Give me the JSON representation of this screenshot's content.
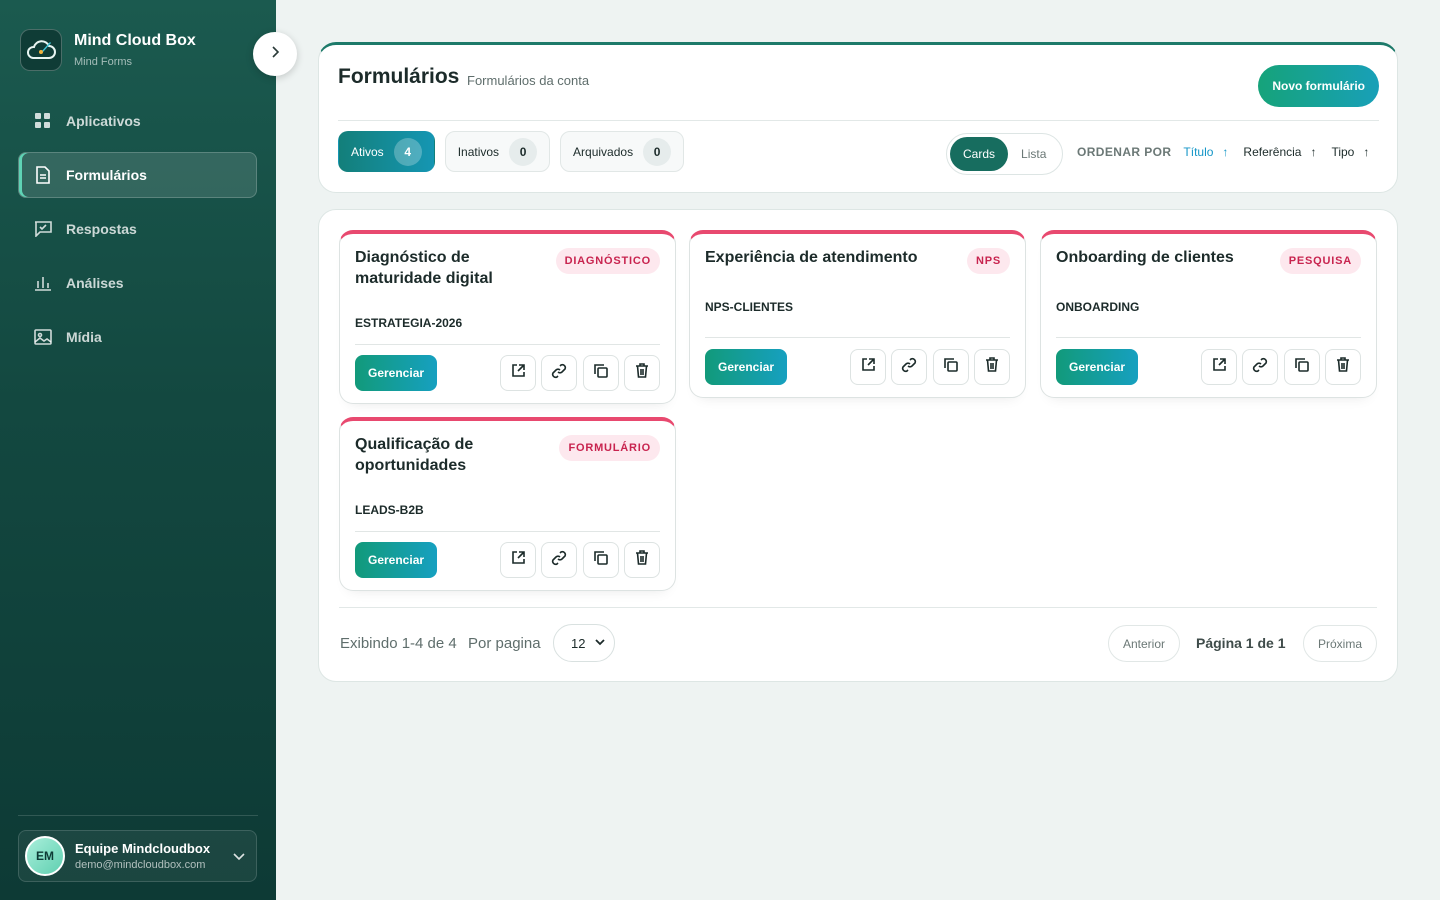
{
  "brand": {
    "name": "Mind Cloud Box",
    "subtitle": "Mind Forms"
  },
  "nav": [
    {
      "label": "Aplicativos",
      "icon": "grid-icon",
      "active": false
    },
    {
      "label": "Formulários",
      "icon": "document-icon",
      "active": true
    },
    {
      "label": "Respostas",
      "icon": "chat-check-icon",
      "active": false
    },
    {
      "label": "Análises",
      "icon": "bar-chart-icon",
      "active": false
    },
    {
      "label": "Mídia",
      "icon": "image-icon",
      "active": false
    }
  ],
  "user": {
    "initials": "EM",
    "name": "Equipe Mindcloudbox",
    "email": "demo@mindcloudbox.com"
  },
  "header": {
    "title": "Formulários",
    "subtitle": "Formulários da conta",
    "new_button": "Novo formulário"
  },
  "filters": [
    {
      "label": "Ativos",
      "count": "4",
      "active": true
    },
    {
      "label": "Inativos",
      "count": "0",
      "active": false
    },
    {
      "label": "Arquivados",
      "count": "0",
      "active": false
    }
  ],
  "view_toggle": {
    "cards": "Cards",
    "list": "Lista",
    "selected": "Cards"
  },
  "sort": {
    "label": "ORDENAR POR",
    "options": [
      {
        "label": "Título",
        "arrow": "↑",
        "active": true
      },
      {
        "label": "Referência",
        "arrow": "↑",
        "active": false
      },
      {
        "label": "Tipo",
        "arrow": "↑",
        "active": false
      }
    ]
  },
  "cards": [
    {
      "title": "Diagnóstico de maturidade digital",
      "tag": "DIAGNÓSTICO",
      "reference": "ESTRATEGIA-2026",
      "manage": "Gerenciar"
    },
    {
      "title": "Experiência de atendimento",
      "tag": "NPS",
      "reference": "NPS-CLIENTES",
      "manage": "Gerenciar"
    },
    {
      "title": "Onboarding de clientes",
      "tag": "PESQUISA",
      "reference": "ONBOARDING",
      "manage": "Gerenciar"
    },
    {
      "title": "Qualificação de oportunidades",
      "tag": "FORMULÁRIO",
      "reference": "LEADS-B2B",
      "manage": "Gerenciar"
    }
  ],
  "pagination": {
    "info": "Exibindo 1-4 de 4",
    "per_page_label": "Por pagina",
    "per_page_value": "12",
    "previous": "Anterior",
    "page_label": "Página 1 de 1",
    "next": "Próxima"
  },
  "colors": {
    "sidebar": "#134840",
    "accent": "#16a37a",
    "tag_border": "#e8496f",
    "sort_active": "#1596c7"
  }
}
